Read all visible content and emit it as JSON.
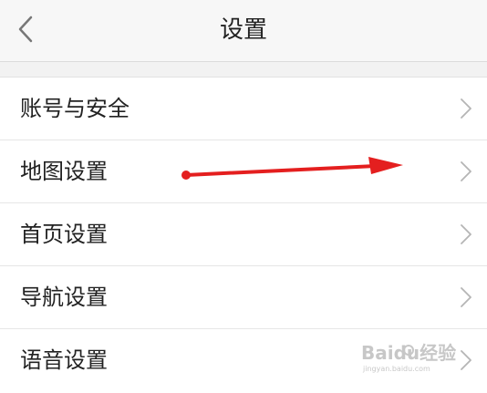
{
  "header": {
    "title": "设置",
    "back_icon": "chevron-left-icon"
  },
  "settings": {
    "items": [
      {
        "label": "账号与安全",
        "icon": "chevron-right-icon"
      },
      {
        "label": "地图设置",
        "icon": "chevron-right-icon"
      },
      {
        "label": "首页设置",
        "icon": "chevron-right-icon"
      },
      {
        "label": "导航设置",
        "icon": "chevron-right-icon"
      },
      {
        "label": "语音设置",
        "icon": "chevron-right-icon"
      }
    ]
  },
  "annotation": {
    "arrow_color": "#e41f1f"
  },
  "watermark": {
    "brand": "Baidu经验",
    "url": "jingyan.baidu.com"
  },
  "colors": {
    "header_bg": "#f7f7f7",
    "page_bg": "#f2f2f2",
    "row_bg": "#ffffff",
    "text": "#222222",
    "chevron": "#b5b5b5"
  }
}
